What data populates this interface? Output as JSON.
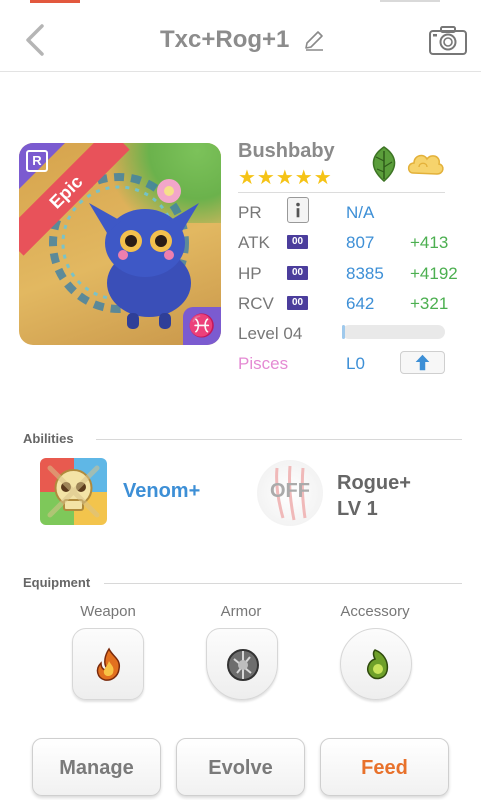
{
  "header": {
    "title": "Txc+Rog+1"
  },
  "monster": {
    "rarity": "Epic",
    "rarity_badge": "R",
    "zodiac_symbol": "♓",
    "name": "Bushbaby",
    "stars": "★★★★★",
    "stats": {
      "pr": {
        "label": "PR",
        "value": "N/A"
      },
      "atk": {
        "label": "ATK",
        "badge": "00",
        "value": "807",
        "plus": "+413"
      },
      "hp": {
        "label": "HP",
        "badge": "00",
        "value": "8385",
        "plus": "+4192"
      },
      "rcv": {
        "label": "RCV",
        "badge": "00",
        "value": "642",
        "plus": "+321"
      }
    },
    "level": {
      "label": "Level 04",
      "progress": 0.03
    },
    "sign": {
      "label": "Pisces",
      "value": "L0"
    }
  },
  "abilities": {
    "title": "Abilities",
    "primary": {
      "name": "Venom+"
    },
    "secondary": {
      "state": "OFF",
      "name": "Rogue+",
      "level": "LV 1"
    }
  },
  "equipment": {
    "title": "Equipment",
    "slots": [
      {
        "label": "Weapon"
      },
      {
        "label": "Armor"
      },
      {
        "label": "Accessory"
      }
    ]
  },
  "actions": {
    "manage": "Manage",
    "evolve": "Evolve",
    "feed": "Feed"
  },
  "colors": {
    "accent_blue": "#3d8fd6",
    "bonus_green": "#4caf50",
    "feed_orange": "#e8712b",
    "epic_red": "#e8525a",
    "zodiac_purple": "#7b5bd0"
  }
}
